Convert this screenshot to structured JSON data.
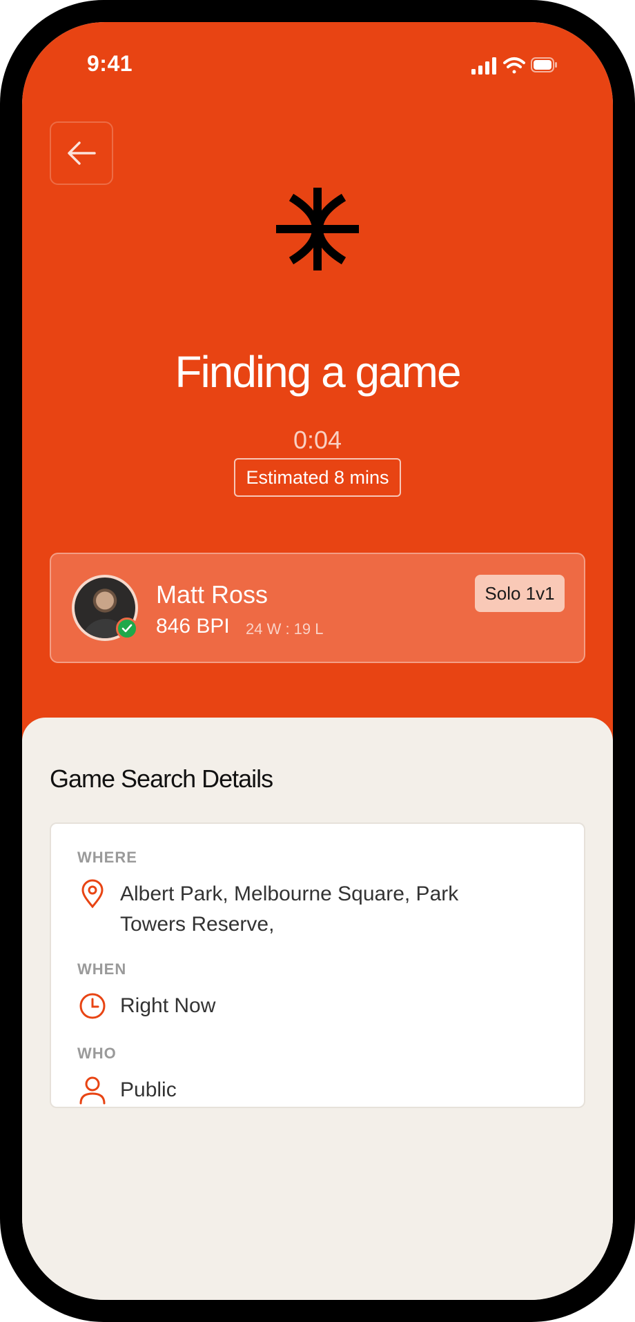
{
  "status_bar": {
    "time": "9:41"
  },
  "header": {
    "title": "Finding a game",
    "timer": "0:04",
    "estimate": "Estimated 8 mins"
  },
  "player": {
    "name": "Matt Ross",
    "bpi": "846 BPI",
    "record": "24 W : 19 L",
    "mode": "Solo 1v1"
  },
  "details": {
    "title": "Game Search Details",
    "where_label": "WHERE",
    "where_value": "Albert Park, Melbourne Square, Park Towers Reserve,",
    "when_label": "WHEN",
    "when_value": "Right Now",
    "who_label": "WHO",
    "who_value": "Public"
  },
  "colors": {
    "brand": "#E84413",
    "card": "#EE6A44",
    "sheet": "#F3EFE9",
    "badge": "#F9C9B7",
    "verified": "#1FA84A"
  },
  "icons": [
    "back-arrow-icon",
    "logo-icon",
    "location-pin-icon",
    "clock-icon",
    "user-icon",
    "check-icon",
    "signal-icon",
    "wifi-icon",
    "battery-icon"
  ]
}
